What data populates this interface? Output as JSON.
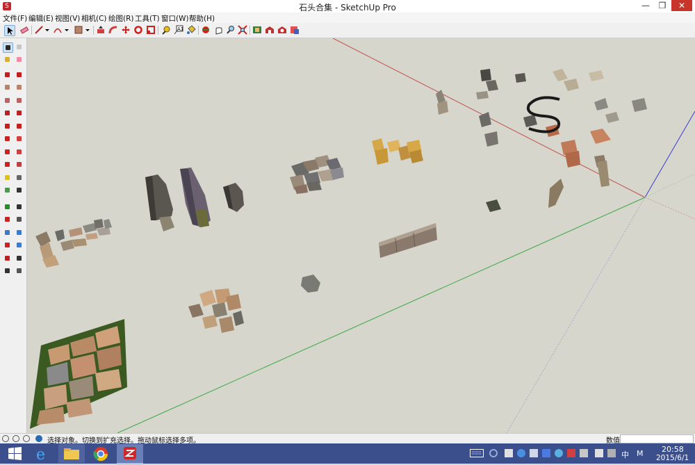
{
  "window": {
    "title": "石头合集 - SketchUp Pro",
    "app_icon": "sketchup-icon",
    "minimize": "—",
    "restore": "❐",
    "close": "✕"
  },
  "menu": [
    {
      "label": "文件(F)"
    },
    {
      "label": "编辑(E)"
    },
    {
      "label": "视图(V)"
    },
    {
      "label": "相机(C)"
    },
    {
      "label": "绘图(R)"
    },
    {
      "label": "工具(T)"
    },
    {
      "label": "窗口(W)"
    },
    {
      "label": "帮助(H)"
    }
  ],
  "toolbar_icons": [
    "select-icon",
    "eraser-icon",
    "pencil-icon",
    "dropdown-arrow-icon",
    "arc-icon",
    "dropdown-arrow-icon",
    "rectangle-icon",
    "dropdown-arrow-icon",
    "push-pull-icon",
    "follow-me-icon",
    "move-icon",
    "rotate-icon",
    "scale-icon",
    "tape-measure-icon",
    "text-icon",
    "paint-bucket-icon",
    "orbit-icon",
    "pan-icon",
    "zoom-extents-icon",
    "component-icon",
    "3d-warehouse-icon",
    "extension-warehouse-icon",
    "send-to-layout-icon"
  ],
  "palette_icons": [
    "select-icon",
    "component-icon",
    "paint-bucket-icon",
    "eraser-icon",
    "line-icon",
    "freehand-icon",
    "rectangle-icon",
    "rotated-rectangle-icon",
    "circle-icon",
    "polygon-icon",
    "arc-icon",
    "pie-icon",
    "two-point-arc-icon",
    "three-point-arc-icon",
    "move-icon",
    "push-pull-icon",
    "rotate-icon",
    "follow-me-icon",
    "scale-icon",
    "offset-icon",
    "tape-measure-icon",
    "dimension-icon",
    "protractor-icon",
    "text-icon",
    "axes-icon",
    "3d-text-icon",
    "orbit-icon",
    "pan-icon",
    "zoom-icon",
    "zoom-window-icon",
    "zoom-extents-icon",
    "previous-view-icon",
    "position-camera-icon",
    "look-around-icon",
    "walk-icon",
    "section-plane-icon"
  ],
  "status": {
    "text": "选择对象。切换到扩充选择。拖动鼠标选择多项。",
    "measurements_label": "数值",
    "measurements_value": ""
  },
  "taskbar": {
    "apps": [
      "windows-start-icon",
      "internet-explorer-icon",
      "file-explorer-icon",
      "chrome-icon",
      "sketchup-icon"
    ],
    "tray_icons": [
      "keyboard-icon",
      "network-icon",
      "app-tray-icon",
      "app-tray-icon",
      "app-tray-icon",
      "app-tray-icon",
      "bluetooth-icon",
      "app-tray-icon",
      "app-tray-icon",
      "app-tray-icon",
      "app-tray-icon",
      "volume-icon",
      "wifi-icon",
      "flag-icon"
    ],
    "ime": "中",
    "ime2": "M",
    "time": "20:58",
    "date": "2015/6/1"
  },
  "colors": {
    "accent_red": "#c8242b",
    "taskbar": "#3a4f8c",
    "viewport_bg": "#d6d6cd",
    "axis_red": "#c0504d",
    "axis_green": "#3aa845",
    "axis_blue": "#3a3ad0"
  }
}
